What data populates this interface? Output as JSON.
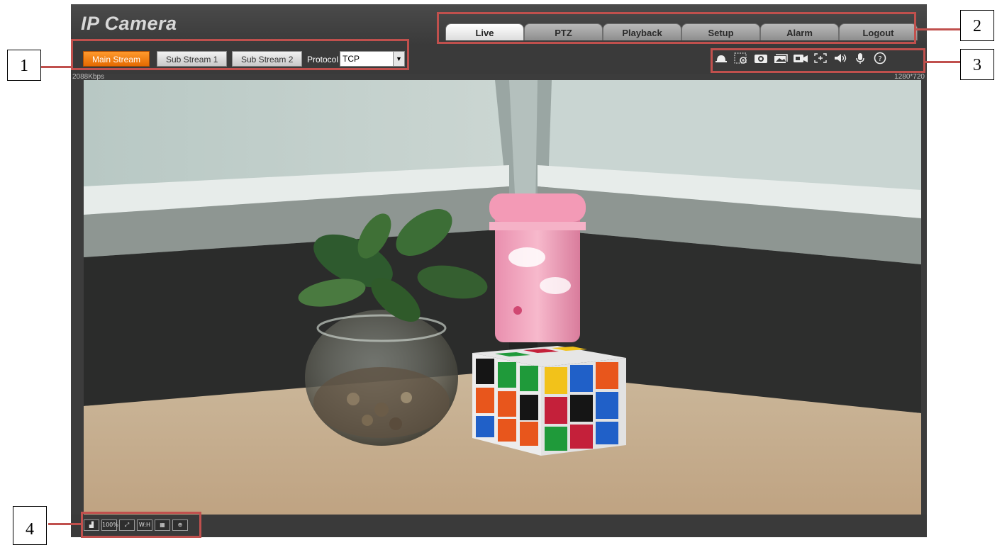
{
  "app": {
    "title": "IP Camera"
  },
  "nav": {
    "tabs": [
      {
        "label": "Live",
        "active": true
      },
      {
        "label": "PTZ"
      },
      {
        "label": "Playback"
      },
      {
        "label": "Setup"
      },
      {
        "label": "Alarm"
      },
      {
        "label": "Logout"
      }
    ]
  },
  "streams": {
    "main": "Main Stream",
    "sub1": "Sub Stream 1",
    "sub2": "Sub Stream 2",
    "active": "Main Stream"
  },
  "protocol": {
    "label": "Protocol",
    "value": "TCP"
  },
  "status": {
    "bitrate": "2088Kbps",
    "resolution": "1280*720"
  },
  "bottom_tools": {
    "zoom_label": "100%",
    "wh_label": "W:H"
  },
  "callouts": [
    "1",
    "2",
    "3",
    "4"
  ],
  "colors": {
    "accent": "#f07a10",
    "callout": "#c0504d"
  }
}
